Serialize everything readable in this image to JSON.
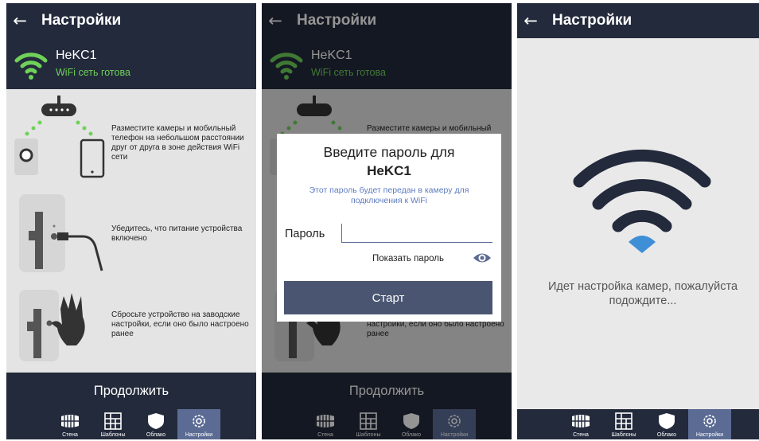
{
  "screens": {
    "setup": {
      "header": {
        "back_glyph": "←",
        "title": "Настройки"
      },
      "network": {
        "ssid": "HeKC1",
        "status": "WiFi сеть готова"
      },
      "steps": [
        {
          "text": "Разместите камеры и мобильный телефон на небольшом расстоянии друг от друга в зоне действия WiFi сети"
        },
        {
          "text": "Убедитесь, что питание устройства включено"
        },
        {
          "text": "Сбросьте устройство на заводские настройки, если оно было настроено ранее"
        }
      ],
      "continue_label": "Продолжить"
    },
    "password": {
      "dialog": {
        "title": "Введите пароль для",
        "ssid": "HeKC1",
        "note": "Этот пароль будет передан в камеру для подключения к WiFi",
        "password_label": "Пароль",
        "password_value": "",
        "show_password_label": "Показать пароль",
        "start_label": "Старт"
      }
    },
    "progress": {
      "header": {
        "back_glyph": "←",
        "title": "Настройки"
      },
      "message": "Идет настройка камер, пожалуйста подождите..."
    }
  },
  "tabs": [
    {
      "label": "Стена",
      "icon": "wall-icon"
    },
    {
      "label": "Шаблоны",
      "icon": "templates-icon"
    },
    {
      "label": "Облако",
      "icon": "cloud-shield-icon"
    },
    {
      "label": "Настройки",
      "icon": "gear-icon"
    }
  ],
  "active_tab": "Настройки",
  "colors": {
    "header_bg": "#232a3b",
    "wifi_green": "#6fd15a",
    "accent": "#5b6b94",
    "wifi_blue": "#3f8fd6",
    "start_button": "#4a5571"
  }
}
